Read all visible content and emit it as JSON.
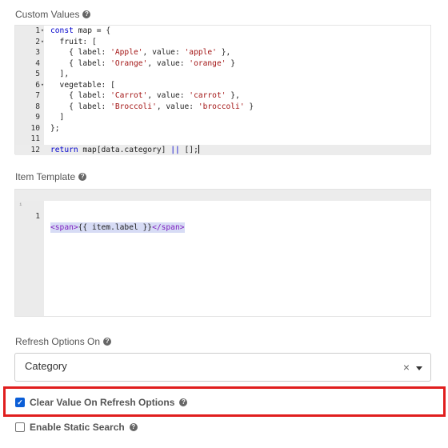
{
  "custom_values": {
    "label": "Custom Values",
    "code_lines": [
      {
        "n": "1",
        "fold": "▾",
        "tokens": [
          {
            "t": "const",
            "c": "kw"
          },
          {
            "t": " map = {",
            "c": ""
          }
        ]
      },
      {
        "n": "2",
        "fold": "▾",
        "tokens": [
          {
            "t": "  fruit: [",
            "c": ""
          }
        ]
      },
      {
        "n": "3",
        "fold": "",
        "tokens": [
          {
            "t": "    { label: ",
            "c": ""
          },
          {
            "t": "'Apple'",
            "c": "str"
          },
          {
            "t": ", value: ",
            "c": ""
          },
          {
            "t": "'apple'",
            "c": "str"
          },
          {
            "t": " },",
            "c": ""
          }
        ]
      },
      {
        "n": "4",
        "fold": "",
        "tokens": [
          {
            "t": "    { label: ",
            "c": ""
          },
          {
            "t": "'Orange'",
            "c": "str"
          },
          {
            "t": ", value: ",
            "c": ""
          },
          {
            "t": "'orange'",
            "c": "str"
          },
          {
            "t": " }",
            "c": ""
          }
        ]
      },
      {
        "n": "5",
        "fold": "",
        "tokens": [
          {
            "t": "  ],",
            "c": ""
          }
        ]
      },
      {
        "n": "6",
        "fold": "▾",
        "tokens": [
          {
            "t": "  vegetable: [",
            "c": ""
          }
        ]
      },
      {
        "n": "7",
        "fold": "",
        "tokens": [
          {
            "t": "    { label: ",
            "c": ""
          },
          {
            "t": "'Carrot'",
            "c": "str"
          },
          {
            "t": ", value: ",
            "c": ""
          },
          {
            "t": "'carrot'",
            "c": "str"
          },
          {
            "t": " },",
            "c": ""
          }
        ]
      },
      {
        "n": "8",
        "fold": "",
        "tokens": [
          {
            "t": "    { label: ",
            "c": ""
          },
          {
            "t": "'Broccoli'",
            "c": "str"
          },
          {
            "t": ", value: ",
            "c": ""
          },
          {
            "t": "'broccoli'",
            "c": "str"
          },
          {
            "t": " }",
            "c": ""
          }
        ]
      },
      {
        "n": "9",
        "fold": "",
        "tokens": [
          {
            "t": "  ]",
            "c": ""
          }
        ]
      },
      {
        "n": "10",
        "fold": "",
        "tokens": [
          {
            "t": "};",
            "c": ""
          }
        ]
      },
      {
        "n": "11",
        "fold": "",
        "tokens": []
      },
      {
        "n": "12",
        "fold": "",
        "active": true,
        "tokens": [
          {
            "t": "return",
            "c": "kw"
          },
          {
            "t": " map[data.category] ",
            "c": ""
          },
          {
            "t": "||",
            "c": "kw"
          },
          {
            "t": " [];",
            "c": ""
          }
        ]
      }
    ]
  },
  "item_template": {
    "label": "Item Template",
    "line_number": "1",
    "gutter_marker": "ⁱ",
    "tokens": [
      {
        "t": "<span>",
        "c": "tag"
      },
      {
        "t": "{{ item.label }}",
        "c": ""
      },
      {
        "t": "</span>",
        "c": "tag"
      }
    ]
  },
  "refresh_options": {
    "label": "Refresh Options On",
    "selected_value": "Category",
    "clear_glyph": "×"
  },
  "clear_value_on_refresh": {
    "label": "Clear Value On Refresh Options",
    "checked": true,
    "check_glyph": "✓"
  },
  "enable_static_search": {
    "label": "Enable Static Search",
    "checked": false
  },
  "help_glyph": "?",
  "colors": {
    "highlight_border": "#e01e1e",
    "checkbox_checked": "#0b5ed7",
    "keyword": "#0000cc",
    "string": "#a31515",
    "tag": "#7f1fbf"
  }
}
